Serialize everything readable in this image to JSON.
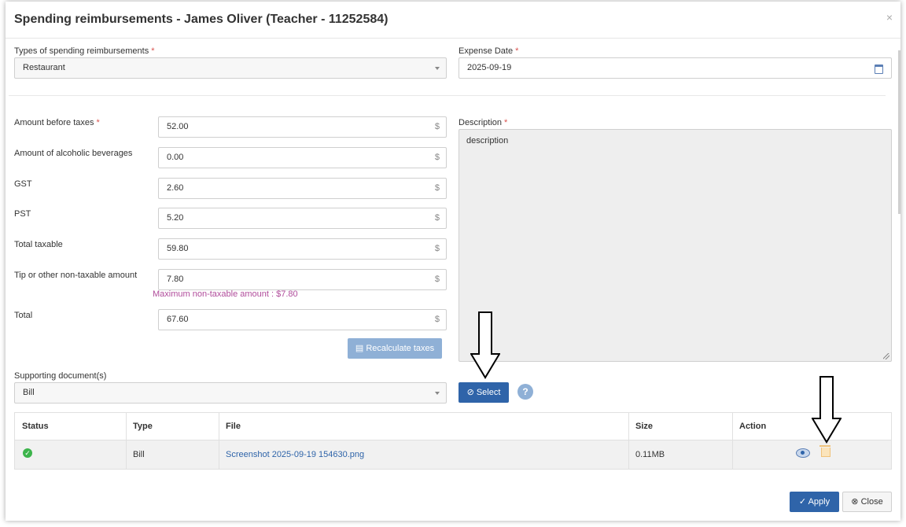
{
  "modal": {
    "title": "Spending reimbursements - James Oliver (Teacher - 11252584)",
    "close_glyph": "×"
  },
  "form": {
    "type_label": "Types of spending reimbursements",
    "type_value": "Restaurant",
    "date_label": "Expense Date",
    "date_value": "2025-09-19",
    "required_mark": "*",
    "amounts": [
      {
        "label": "Amount before taxes",
        "value": "52.00",
        "required": "*"
      },
      {
        "label": "Amount of alcoholic beverages",
        "value": "0.00"
      },
      {
        "label": "GST",
        "value": "2.60"
      },
      {
        "label": "PST",
        "value": "5.20"
      },
      {
        "label": "Total taxable",
        "value": "59.80"
      },
      {
        "label": "Tip or other non-taxable amount",
        "value": "7.80"
      },
      {
        "label": "Total",
        "value": "67.60"
      }
    ],
    "currency_symbol": "$",
    "max_hint": "Maximum non-taxable amount : $7.80",
    "recalc_label": "Recalculate taxes",
    "description_label": "Description",
    "description_value": "description",
    "docs_label": "Supporting document(s)",
    "docs_value": "Bill",
    "select_label": "Select",
    "help_glyph": "?"
  },
  "table": {
    "headers": [
      "Status",
      "Type",
      "File",
      "Size",
      "Action"
    ],
    "rows": [
      {
        "status_icon": "check-circle-icon",
        "type": "Bill",
        "file": "Screenshot 2025-09-19 154630.png",
        "size": "0.11MB"
      }
    ]
  },
  "footer": {
    "apply_label": "Apply",
    "close_label": "Close"
  },
  "icons": {
    "attach": "paperclip-icon",
    "calendar": "calendar-icon",
    "view": "eye-icon",
    "delete": "trash-icon"
  },
  "colors": {
    "primary": "#2f64a9",
    "primary_light": "#8fb0d6",
    "hint": "#b04c9b",
    "required": "#d9534f",
    "success": "#3cb44b"
  }
}
